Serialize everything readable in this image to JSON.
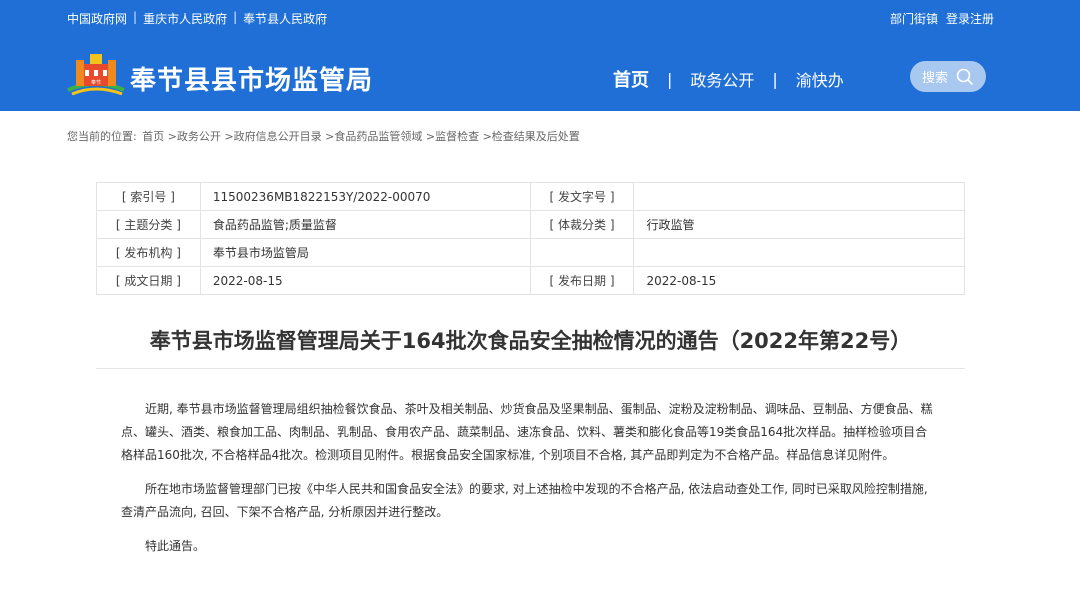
{
  "header": {
    "top_links": [
      "中国政府网",
      "重庆市人民政府",
      "奉节县人民政府"
    ],
    "right_links": [
      "部门街镇",
      "登录注册"
    ],
    "site_name": "奉节县县市场监管局",
    "nav": [
      "首页",
      "政务公开",
      "渝快办"
    ],
    "search_label": "搜索",
    "logo_text": "奉节"
  },
  "breadcrumb": [
    "您当前的位置:",
    "首页",
    ">政务公开",
    ">政府信息公开目录",
    ">食品药品监管领域",
    ">监督检查",
    ">检查结果及后处置"
  ],
  "meta": {
    "index_label": "[ 索引号 ]",
    "index_value": "11500236MB1822153Y/2022-00070",
    "docno_label": "[ 发文字号 ]",
    "docno_value": "",
    "topic_label": "[ 主题分类 ]",
    "topic_value": "食品药品监管;质量监督",
    "genre_label": "[ 体裁分类 ]",
    "genre_value": "行政监管",
    "org_label": "[ 发布机构 ]",
    "org_value": "奉节县市场监管局",
    "created_label": "[ 成文日期 ]",
    "created_value": "2022-08-15",
    "published_label": "[ 发布日期 ]",
    "published_value": "2022-08-15"
  },
  "article": {
    "title": "奉节县市场监督管理局关于164批次食品安全抽检情况的通告（2022年第22号）",
    "paragraphs": [
      "近期, 奉节县市场监督管理局组织抽检餐饮食品、茶叶及相关制品、炒货食品及坚果制品、蛋制品、淀粉及淀粉制品、调味品、豆制品、方便食品、糕点、罐头、酒类、粮食加工品、肉制品、乳制品、食用农产品、蔬菜制品、速冻食品、饮料、薯类和膨化食品等19类食品164批次样品。抽样检验项目合格样品160批次, 不合格样品4批次。检测项目见附件。根据食品安全国家标准, 个别项目不合格, 其产品即判定为不合格产品。样品信息详见附件。",
      "所在地市场监督管理部门已按《中华人民共和国食品安全法》的要求, 对上述抽检中发现的不合格产品, 依法启动查处工作, 同时已采取风险控制措施, 查清产品流向, 召回、下架不合格产品, 分析原因并进行整改。",
      "特此通告。"
    ]
  },
  "colors": {
    "header_bg": "#1f6fd6",
    "search_bg": "#a8c8f0"
  },
  "icons": {
    "search": "search-icon",
    "logo": "emblem-logo-icon"
  }
}
